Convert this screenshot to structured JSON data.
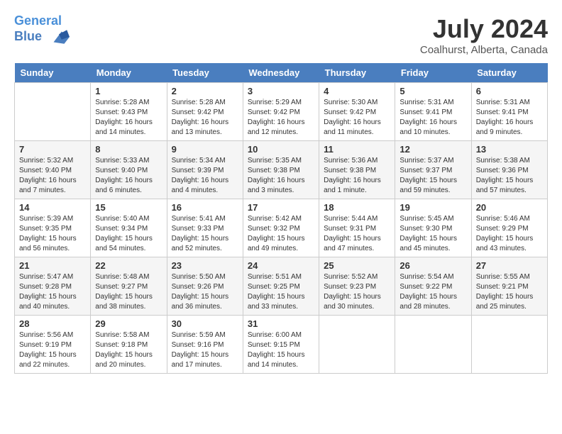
{
  "header": {
    "logo_line1": "General",
    "logo_line2": "Blue",
    "month": "July 2024",
    "location": "Coalhurst, Alberta, Canada"
  },
  "days_of_week": [
    "Sunday",
    "Monday",
    "Tuesday",
    "Wednesday",
    "Thursday",
    "Friday",
    "Saturday"
  ],
  "weeks": [
    [
      {
        "day": "",
        "info": ""
      },
      {
        "day": "1",
        "info": "Sunrise: 5:28 AM\nSunset: 9:43 PM\nDaylight: 16 hours\nand 14 minutes."
      },
      {
        "day": "2",
        "info": "Sunrise: 5:28 AM\nSunset: 9:42 PM\nDaylight: 16 hours\nand 13 minutes."
      },
      {
        "day": "3",
        "info": "Sunrise: 5:29 AM\nSunset: 9:42 PM\nDaylight: 16 hours\nand 12 minutes."
      },
      {
        "day": "4",
        "info": "Sunrise: 5:30 AM\nSunset: 9:42 PM\nDaylight: 16 hours\nand 11 minutes."
      },
      {
        "day": "5",
        "info": "Sunrise: 5:31 AM\nSunset: 9:41 PM\nDaylight: 16 hours\nand 10 minutes."
      },
      {
        "day": "6",
        "info": "Sunrise: 5:31 AM\nSunset: 9:41 PM\nDaylight: 16 hours\nand 9 minutes."
      }
    ],
    [
      {
        "day": "7",
        "info": "Sunrise: 5:32 AM\nSunset: 9:40 PM\nDaylight: 16 hours\nand 7 minutes."
      },
      {
        "day": "8",
        "info": "Sunrise: 5:33 AM\nSunset: 9:40 PM\nDaylight: 16 hours\nand 6 minutes."
      },
      {
        "day": "9",
        "info": "Sunrise: 5:34 AM\nSunset: 9:39 PM\nDaylight: 16 hours\nand 4 minutes."
      },
      {
        "day": "10",
        "info": "Sunrise: 5:35 AM\nSunset: 9:38 PM\nDaylight: 16 hours\nand 3 minutes."
      },
      {
        "day": "11",
        "info": "Sunrise: 5:36 AM\nSunset: 9:38 PM\nDaylight: 16 hours\nand 1 minute."
      },
      {
        "day": "12",
        "info": "Sunrise: 5:37 AM\nSunset: 9:37 PM\nDaylight: 15 hours\nand 59 minutes."
      },
      {
        "day": "13",
        "info": "Sunrise: 5:38 AM\nSunset: 9:36 PM\nDaylight: 15 hours\nand 57 minutes."
      }
    ],
    [
      {
        "day": "14",
        "info": "Sunrise: 5:39 AM\nSunset: 9:35 PM\nDaylight: 15 hours\nand 56 minutes."
      },
      {
        "day": "15",
        "info": "Sunrise: 5:40 AM\nSunset: 9:34 PM\nDaylight: 15 hours\nand 54 minutes."
      },
      {
        "day": "16",
        "info": "Sunrise: 5:41 AM\nSunset: 9:33 PM\nDaylight: 15 hours\nand 52 minutes."
      },
      {
        "day": "17",
        "info": "Sunrise: 5:42 AM\nSunset: 9:32 PM\nDaylight: 15 hours\nand 49 minutes."
      },
      {
        "day": "18",
        "info": "Sunrise: 5:44 AM\nSunset: 9:31 PM\nDaylight: 15 hours\nand 47 minutes."
      },
      {
        "day": "19",
        "info": "Sunrise: 5:45 AM\nSunset: 9:30 PM\nDaylight: 15 hours\nand 45 minutes."
      },
      {
        "day": "20",
        "info": "Sunrise: 5:46 AM\nSunset: 9:29 PM\nDaylight: 15 hours\nand 43 minutes."
      }
    ],
    [
      {
        "day": "21",
        "info": "Sunrise: 5:47 AM\nSunset: 9:28 PM\nDaylight: 15 hours\nand 40 minutes."
      },
      {
        "day": "22",
        "info": "Sunrise: 5:48 AM\nSunset: 9:27 PM\nDaylight: 15 hours\nand 38 minutes."
      },
      {
        "day": "23",
        "info": "Sunrise: 5:50 AM\nSunset: 9:26 PM\nDaylight: 15 hours\nand 36 minutes."
      },
      {
        "day": "24",
        "info": "Sunrise: 5:51 AM\nSunset: 9:25 PM\nDaylight: 15 hours\nand 33 minutes."
      },
      {
        "day": "25",
        "info": "Sunrise: 5:52 AM\nSunset: 9:23 PM\nDaylight: 15 hours\nand 30 minutes."
      },
      {
        "day": "26",
        "info": "Sunrise: 5:54 AM\nSunset: 9:22 PM\nDaylight: 15 hours\nand 28 minutes."
      },
      {
        "day": "27",
        "info": "Sunrise: 5:55 AM\nSunset: 9:21 PM\nDaylight: 15 hours\nand 25 minutes."
      }
    ],
    [
      {
        "day": "28",
        "info": "Sunrise: 5:56 AM\nSunset: 9:19 PM\nDaylight: 15 hours\nand 22 minutes."
      },
      {
        "day": "29",
        "info": "Sunrise: 5:58 AM\nSunset: 9:18 PM\nDaylight: 15 hours\nand 20 minutes."
      },
      {
        "day": "30",
        "info": "Sunrise: 5:59 AM\nSunset: 9:16 PM\nDaylight: 15 hours\nand 17 minutes."
      },
      {
        "day": "31",
        "info": "Sunrise: 6:00 AM\nSunset: 9:15 PM\nDaylight: 15 hours\nand 14 minutes."
      },
      {
        "day": "",
        "info": ""
      },
      {
        "day": "",
        "info": ""
      },
      {
        "day": "",
        "info": ""
      }
    ]
  ]
}
